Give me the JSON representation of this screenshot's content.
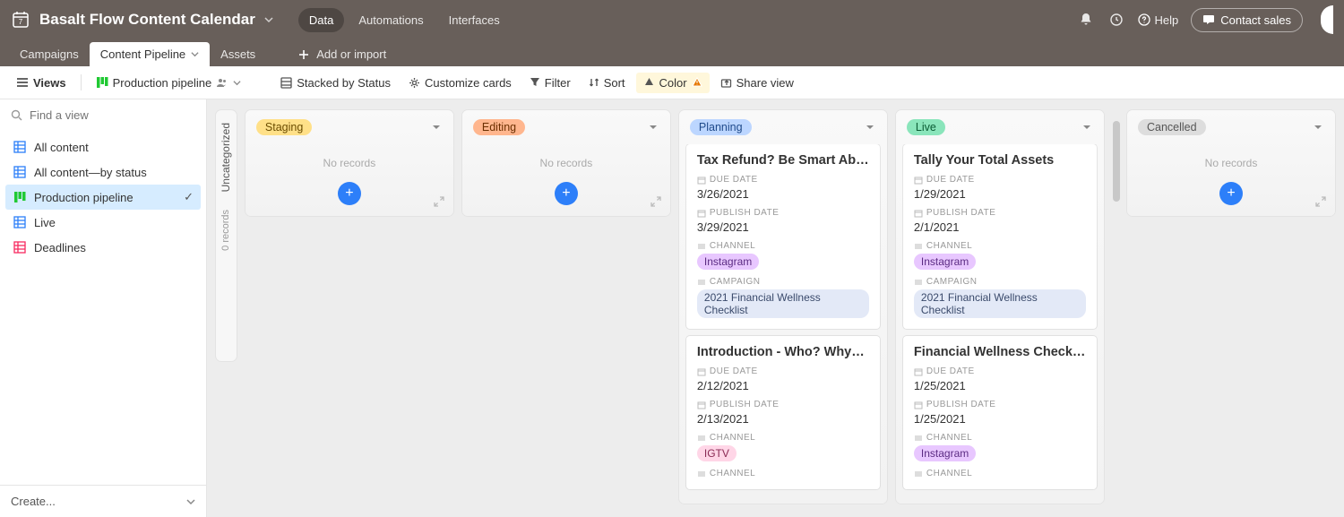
{
  "header": {
    "title": "Basalt Flow Content Calendar",
    "nav": {
      "data": "Data",
      "automations": "Automations",
      "interfaces": "Interfaces"
    },
    "help": "Help",
    "contact": "Contact sales"
  },
  "tabs": {
    "campaigns": "Campaigns",
    "pipeline": "Content Pipeline",
    "assets": "Assets",
    "add": "Add or import"
  },
  "toolbar": {
    "views": "Views",
    "current_view": "Production pipeline",
    "stacked": "Stacked by Status",
    "customize": "Customize cards",
    "filter": "Filter",
    "sort": "Sort",
    "color": "Color",
    "share": "Share view"
  },
  "sidebar": {
    "search_placeholder": "Find a view",
    "items": [
      {
        "label": "All content",
        "icon": "grid-blue"
      },
      {
        "label": "All content—by status",
        "icon": "grid-blue"
      },
      {
        "label": "Production pipeline",
        "icon": "grid-green",
        "active": true
      },
      {
        "label": "Live",
        "icon": "grid-blue"
      },
      {
        "label": "Deadlines",
        "icon": "grid-red"
      }
    ],
    "create": "Create..."
  },
  "board": {
    "uncategorized": {
      "label": "Uncategorized",
      "count": "0 records"
    },
    "no_records": "No records",
    "columns": [
      {
        "name": "Staging",
        "pill": "pill-staging",
        "cards": []
      },
      {
        "name": "Editing",
        "pill": "pill-editing",
        "cards": []
      },
      {
        "name": "Planning",
        "pill": "pill-planning",
        "cards": [
          {
            "title": "Tax Refund? Be Smart Abo...",
            "due": "3/26/2021",
            "publish": "3/29/2021",
            "channel": "Instagram",
            "channel_tag": "tag-instagram",
            "campaign": "2021 Financial Wellness Checklist"
          },
          {
            "title": "Introduction - Who? Why?...",
            "due": "2/12/2021",
            "publish": "2/13/2021",
            "channel": "IGTV",
            "channel_tag": "tag-igtv",
            "campaign": ""
          }
        ]
      },
      {
        "name": "Live",
        "pill": "pill-live",
        "cards": [
          {
            "title": "Tally Your Total Assets",
            "due": "1/29/2021",
            "publish": "2/1/2021",
            "channel": "Instagram",
            "channel_tag": "tag-instagram",
            "campaign": "2021 Financial Wellness Checklist"
          },
          {
            "title": "Financial Wellness Checklis...",
            "due": "1/25/2021",
            "publish": "1/25/2021",
            "channel": "Instagram",
            "channel_tag": "tag-instagram",
            "campaign": ""
          }
        ]
      },
      {
        "name": "Cancelled",
        "pill": "pill-cancelled",
        "cards": []
      }
    ],
    "field_labels": {
      "due": "DUE DATE",
      "publish": "PUBLISH DATE",
      "channel": "CHANNEL",
      "campaign": "CAMPAIGN"
    }
  }
}
